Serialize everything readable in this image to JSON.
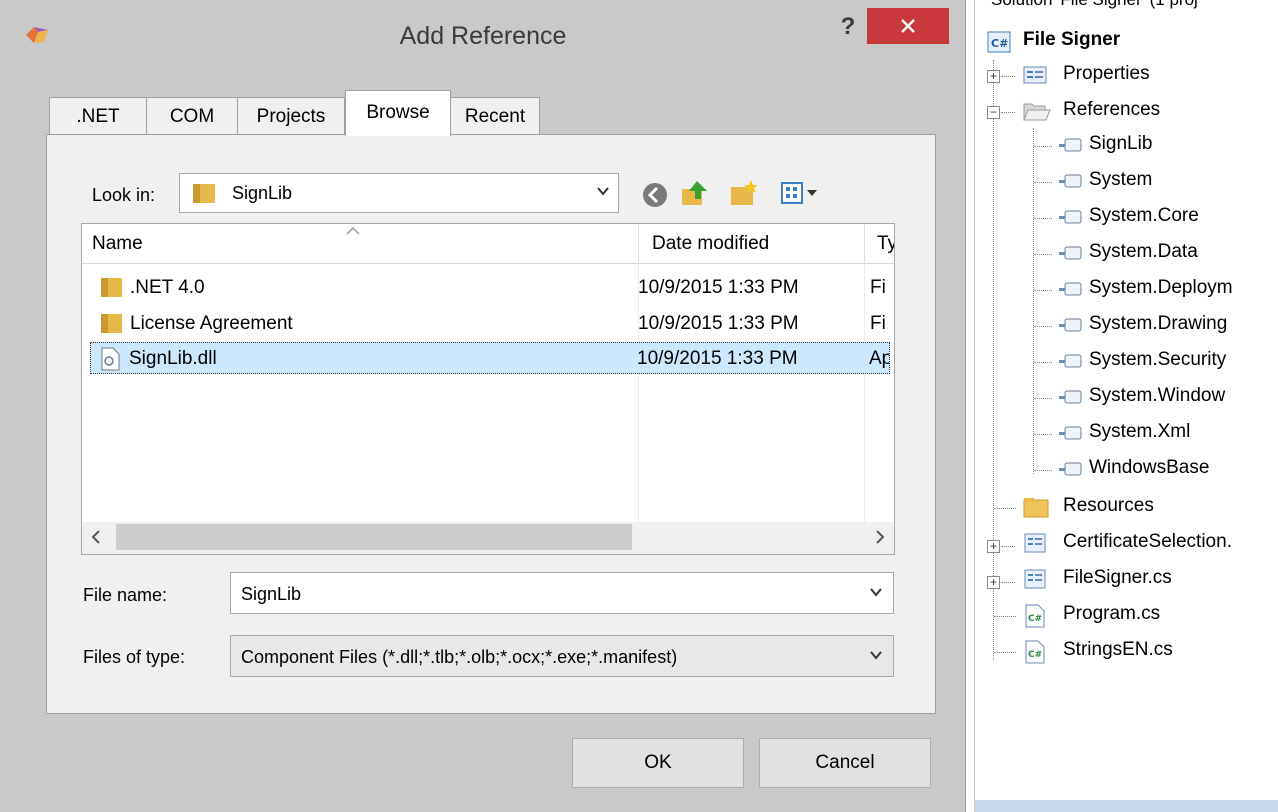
{
  "dialog": {
    "title": "Add Reference",
    "help_label": "?",
    "tabs": [
      {
        "label": ".NET",
        "active": false
      },
      {
        "label": "COM",
        "active": false
      },
      {
        "label": "Projects",
        "active": false
      },
      {
        "label": "Browse",
        "active": true
      },
      {
        "label": "Recent",
        "active": false
      }
    ],
    "look_in": {
      "label": "Look in:",
      "value": "SignLib"
    },
    "file_list": {
      "columns": {
        "name": "Name",
        "date": "Date modified",
        "type": "Ty"
      },
      "rows": [
        {
          "name": ".NET 4.0",
          "date": "10/9/2015 1:33 PM",
          "type": "Fi",
          "icon": "folder-icon",
          "selected": false
        },
        {
          "name": "License Agreement",
          "date": "10/9/2015 1:33 PM",
          "type": "Fi",
          "icon": "folder-icon",
          "selected": false
        },
        {
          "name": "SignLib.dll",
          "date": "10/9/2015 1:33 PM",
          "type": "Ap",
          "icon": "dll-file-icon",
          "selected": true
        }
      ]
    },
    "file_name": {
      "label": "File name:",
      "value": "SignLib"
    },
    "files_of_type": {
      "label": "Files of type:",
      "value": "Component Files (*.dll;*.tlb;*.olb;*.ocx;*.exe;*.manifest)"
    },
    "ok_label": "OK",
    "cancel_label": "Cancel"
  },
  "explorer": {
    "solution_title": "Solution 'File Signer' (1 proj",
    "project": "File Signer",
    "properties": "Properties",
    "references": "References",
    "reference_items": [
      "SignLib",
      "System",
      "System.Core",
      "System.Data",
      "System.Deploym",
      "System.Drawing",
      "System.Security",
      "System.Window",
      "System.Xml",
      "WindowsBase"
    ],
    "resources": "Resources",
    "files": [
      {
        "label": "CertificateSelection.",
        "icon": "form-icon",
        "expandable": true
      },
      {
        "label": "FileSigner.cs",
        "icon": "form-icon",
        "expandable": true
      },
      {
        "label": "Program.cs",
        "icon": "csharp-file-icon",
        "expandable": false
      },
      {
        "label": "StringsEN.cs",
        "icon": "csharp-file-icon",
        "expandable": false
      }
    ]
  },
  "colors": {
    "close_button": "#c8383a",
    "dialog_bg": "#c9c9c9",
    "selection": "#cce8ff",
    "folder": "#e8b84a"
  }
}
